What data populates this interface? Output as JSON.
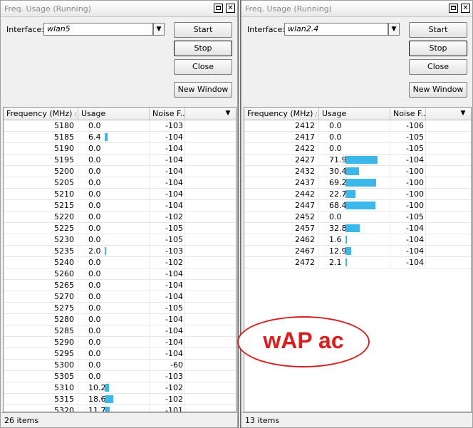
{
  "left": {
    "title": "Freq. Usage (Running)",
    "max_icon": "maximize-icon",
    "close_icon": "close-icon",
    "interface_label": "Interface:",
    "interface_value": "wlan5",
    "interface_drop": "▼",
    "buttons": {
      "start": "Start",
      "stop": "Stop",
      "close": "Close",
      "new_window": "New Window"
    },
    "columns": {
      "frequency": "Frequency (MHz)",
      "usage": "Usage",
      "noise": "Noise F..."
    },
    "sort_mark": "/",
    "header_drop": "▼",
    "rows": [
      {
        "freq": "5180",
        "usage": "0.0",
        "noise": "-103",
        "pct": 0.0
      },
      {
        "freq": "5185",
        "usage": "6.4",
        "noise": "-104",
        "pct": 6.4
      },
      {
        "freq": "5190",
        "usage": "0.0",
        "noise": "-104",
        "pct": 0.0
      },
      {
        "freq": "5195",
        "usage": "0.0",
        "noise": "-104",
        "pct": 0.0
      },
      {
        "freq": "5200",
        "usage": "0.0",
        "noise": "-104",
        "pct": 0.0
      },
      {
        "freq": "5205",
        "usage": "0.0",
        "noise": "-104",
        "pct": 0.0
      },
      {
        "freq": "5210",
        "usage": "0.0",
        "noise": "-104",
        "pct": 0.0
      },
      {
        "freq": "5215",
        "usage": "0.0",
        "noise": "-104",
        "pct": 0.0
      },
      {
        "freq": "5220",
        "usage": "0.0",
        "noise": "-102",
        "pct": 0.0
      },
      {
        "freq": "5225",
        "usage": "0.0",
        "noise": "-105",
        "pct": 0.0
      },
      {
        "freq": "5230",
        "usage": "0.0",
        "noise": "-105",
        "pct": 0.0
      },
      {
        "freq": "5235",
        "usage": "2.0",
        "noise": "-103",
        "pct": 2.0
      },
      {
        "freq": "5240",
        "usage": "0.0",
        "noise": "-102",
        "pct": 0.0
      },
      {
        "freq": "5260",
        "usage": "0.0",
        "noise": "-104",
        "pct": 0.0
      },
      {
        "freq": "5265",
        "usage": "0.0",
        "noise": "-104",
        "pct": 0.0
      },
      {
        "freq": "5270",
        "usage": "0.0",
        "noise": "-104",
        "pct": 0.0
      },
      {
        "freq": "5275",
        "usage": "0.0",
        "noise": "-105",
        "pct": 0.0
      },
      {
        "freq": "5280",
        "usage": "0.0",
        "noise": "-104",
        "pct": 0.0
      },
      {
        "freq": "5285",
        "usage": "0.0",
        "noise": "-104",
        "pct": 0.0
      },
      {
        "freq": "5290",
        "usage": "0.0",
        "noise": "-104",
        "pct": 0.0
      },
      {
        "freq": "5295",
        "usage": "0.0",
        "noise": "-104",
        "pct": 0.0
      },
      {
        "freq": "5300",
        "usage": "0.0",
        "noise": "-60",
        "pct": 0.0
      },
      {
        "freq": "5305",
        "usage": "0.0",
        "noise": "-103",
        "pct": 0.0
      },
      {
        "freq": "5310",
        "usage": "10.2",
        "noise": "-102",
        "pct": 10.2
      },
      {
        "freq": "5315",
        "usage": "18.6",
        "noise": "-102",
        "pct": 18.6
      },
      {
        "freq": "5320",
        "usage": "11.7",
        "noise": "-101",
        "pct": 11.7
      }
    ],
    "status": "26 items"
  },
  "right": {
    "title": "Freq. Usage (Running)",
    "max_icon": "maximize-icon",
    "close_icon": "close-icon",
    "interface_label": "Interface:",
    "interface_value": "wlan2.4",
    "interface_drop": "▼",
    "buttons": {
      "start": "Start",
      "stop": "Stop",
      "close": "Close",
      "new_window": "New Window"
    },
    "columns": {
      "frequency": "Frequency (MHz)",
      "usage": "Usage",
      "noise": "Noise F..."
    },
    "sort_mark": "/",
    "header_drop": "▼",
    "rows": [
      {
        "freq": "2412",
        "usage": "0.0",
        "noise": "-106",
        "pct": 0.0
      },
      {
        "freq": "2417",
        "usage": "0.0",
        "noise": "-105",
        "pct": 0.0
      },
      {
        "freq": "2422",
        "usage": "0.0",
        "noise": "-105",
        "pct": 0.0
      },
      {
        "freq": "2427",
        "usage": "71.9",
        "noise": "-104",
        "pct": 71.9
      },
      {
        "freq": "2432",
        "usage": "30.4",
        "noise": "-100",
        "pct": 30.4
      },
      {
        "freq": "2437",
        "usage": "69.2",
        "noise": "-100",
        "pct": 69.2
      },
      {
        "freq": "2442",
        "usage": "22.7",
        "noise": "-100",
        "pct": 22.7
      },
      {
        "freq": "2447",
        "usage": "68.4",
        "noise": "-100",
        "pct": 68.4
      },
      {
        "freq": "2452",
        "usage": "0.0",
        "noise": "-105",
        "pct": 0.0
      },
      {
        "freq": "2457",
        "usage": "32.8",
        "noise": "-104",
        "pct": 32.8
      },
      {
        "freq": "2462",
        "usage": "1.6",
        "noise": "-104",
        "pct": 1.6
      },
      {
        "freq": "2467",
        "usage": "12.9",
        "noise": "-104",
        "pct": 12.9
      },
      {
        "freq": "2472",
        "usage": "2.1",
        "noise": "-104",
        "pct": 2.1
      }
    ],
    "status": "13 items"
  },
  "annotation": {
    "text": "wAP ac",
    "color": "#d81e1e"
  },
  "colors": {
    "usage_bar": "#3cb7ea"
  }
}
